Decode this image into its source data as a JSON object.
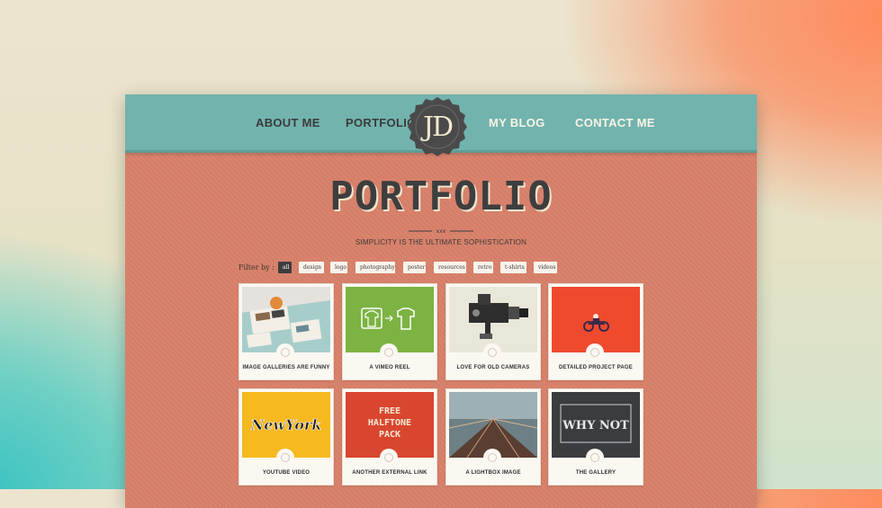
{
  "nav": {
    "items": [
      "ABOUT ME",
      "PORTFOLIO",
      "MY BLOG",
      "CONTACT ME"
    ],
    "logo": "JD"
  },
  "page": {
    "title": "PORTFOLIO",
    "subtitle": "SIMPLICITY IS THE ULTIMATE SOPHISTICATION"
  },
  "filter": {
    "label": "Filter by :",
    "options": [
      "all",
      "design",
      "logo",
      "photography",
      "poster",
      "resources",
      "retro",
      "t-shirts",
      "videos"
    ],
    "active": "all"
  },
  "cards": [
    {
      "title": "IMAGE GALLERIES ARE FUNNY",
      "icon": "image-icon"
    },
    {
      "title": "A VIMEO REEL",
      "icon": "video-icon"
    },
    {
      "title": "LOVE FOR OLD CAMERAS",
      "icon": "image-icon"
    },
    {
      "title": "DETAILED PROJECT PAGE",
      "icon": "document-icon"
    },
    {
      "title": "YOUTUBE VIDEO",
      "icon": "video-icon"
    },
    {
      "title": "ANOTHER EXTERNAL LINK",
      "icon": "link-icon"
    },
    {
      "title": "A LIGHTBOX IMAGE",
      "icon": "image-icon"
    },
    {
      "title": "THE GALLERY",
      "icon": "image-icon"
    }
  ],
  "thumb_text": {
    "newyork": "NewYork",
    "halftone": [
      "FREE",
      "HALFTONE",
      "PACK"
    ],
    "whynot": "WHY NOT"
  },
  "colors": {
    "nav_bg": "#72b3ae",
    "page_bg": "#d8806a",
    "logo_bg": "#4a4a4a",
    "active_chip": "#3d3d3d"
  }
}
